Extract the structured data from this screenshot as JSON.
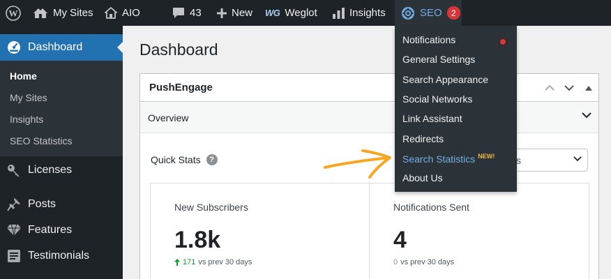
{
  "adminbar": {
    "wp_logo": "wordpress-icon",
    "my_sites": "My Sites",
    "site_name": "AIO",
    "comments_count": "43",
    "new_label": "New",
    "weglot_logo": "WG",
    "weglot_label": "Weglot",
    "insights_label": "Insights",
    "seo_label": "SEO",
    "seo_count": "2"
  },
  "sidebar": {
    "dashboard": "Dashboard",
    "submenu": [
      "Home",
      "My Sites",
      "Insights",
      "SEO Statistics"
    ],
    "items": [
      "Licenses",
      "Posts",
      "Features",
      "Testimonials"
    ]
  },
  "main": {
    "title": "Dashboard",
    "panel": {
      "title": "PushEngage",
      "overview": "Overview",
      "quick_stats": "Quick Stats",
      "help": "?",
      "range_partial": "s",
      "stats": [
        {
          "label": "New Subscribers",
          "value": "1.8k",
          "change_num": "171",
          "change_text": "vs prev 30 days"
        },
        {
          "label": "Notifications Sent",
          "value": "4",
          "change_num": "0",
          "change_text": "vs prev 30 days"
        }
      ]
    }
  },
  "seo_menu": {
    "items": [
      "Notifications",
      "General Settings",
      "Search Appearance",
      "Social Networks",
      "Link Assistant",
      "Redirects",
      "Search Statistics",
      "About Us"
    ],
    "new_badge": "NEW!"
  },
  "colors": {
    "adminbar_bg": "#1d2327",
    "accent": "#2271b1",
    "seo_highlight": "#72aee6",
    "badge_red": "#d63638",
    "arrow_orange": "#f5a623",
    "new_badge": "#f0b849"
  }
}
